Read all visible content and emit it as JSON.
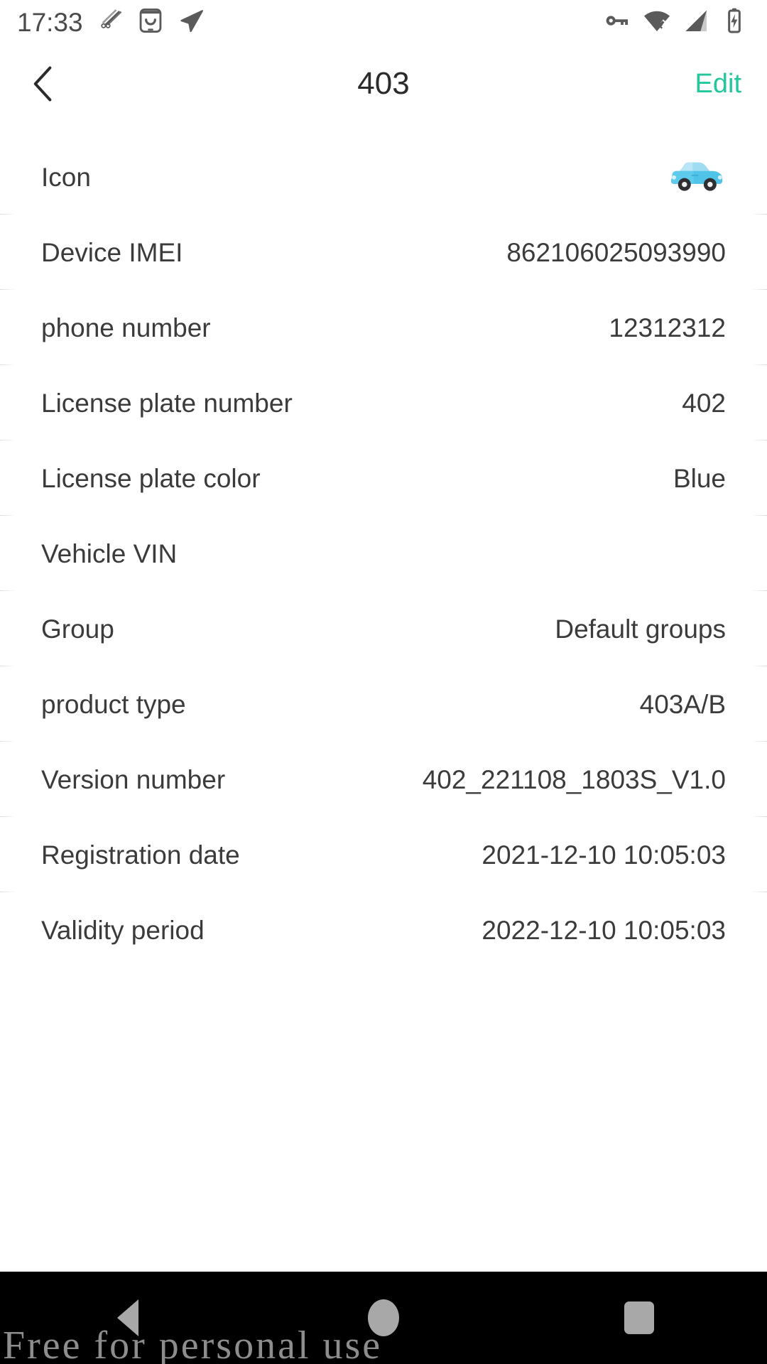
{
  "status_bar": {
    "time": "17:33",
    "left_icons": [
      "cut-screenshot-icon",
      "app-smiley-icon",
      "location-send-icon"
    ],
    "right_icons": [
      "vpn-key-icon",
      "wifi-disconnected-icon",
      "cellular-signal-icon",
      "battery-charging-icon"
    ]
  },
  "header": {
    "title": "403",
    "back_label": "Back",
    "edit_label": "Edit",
    "accent_color": "#22c79b"
  },
  "rows": [
    {
      "label": "Icon",
      "value": "",
      "value_type": "icon",
      "icon": "car-icon"
    },
    {
      "label": "Device IMEI",
      "value": "862106025093990",
      "value_type": "text"
    },
    {
      "label": "phone number",
      "value": "12312312",
      "value_type": "text"
    },
    {
      "label": "License plate number",
      "value": "402",
      "value_type": "text"
    },
    {
      "label": "License plate color",
      "value": "Blue",
      "value_type": "text"
    },
    {
      "label": "Vehicle VIN",
      "value": "",
      "value_type": "text"
    },
    {
      "label": "Group",
      "value": "Default groups",
      "value_type": "text"
    },
    {
      "label": "product type",
      "value": "403A/B",
      "value_type": "text"
    },
    {
      "label": "Version number",
      "value": "402_221108_1803S_V1.0",
      "value_type": "text"
    },
    {
      "label": "Registration date",
      "value": "2021-12-10 10:05:03",
      "value_type": "text"
    },
    {
      "label": "Validity period",
      "value": "2022-12-10 10:05:03",
      "value_type": "text"
    }
  ],
  "nav_bar": {
    "back_label": "Back",
    "home_label": "Home",
    "recents_label": "Recent apps",
    "watermark": "Free for personal use"
  },
  "colors": {
    "page_background": "#ffffff",
    "text_primary": "#3b3b3b",
    "accent": "#22c79b",
    "nav_background": "#000000",
    "car_body": "#4fc3e8"
  }
}
